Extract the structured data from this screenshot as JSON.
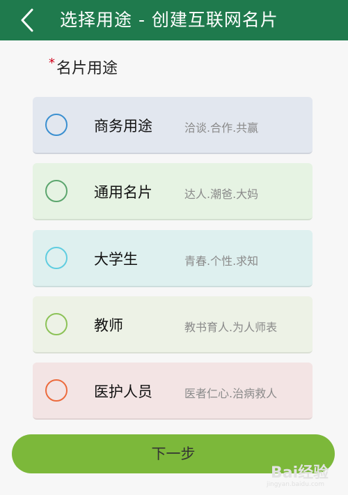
{
  "header": {
    "back_icon": "chevron-left-icon",
    "title": "选择用途 - 创建互联网名片",
    "bg": "#1f7a4d"
  },
  "section": {
    "required_mark": "*",
    "label": "名片用途"
  },
  "options": [
    {
      "name": "商务用途",
      "desc": "洽谈.合作.共赢",
      "bg": "#e2e7ef",
      "ring": "#3a8fd0"
    },
    {
      "name": "通用名片",
      "desc": "达人.潮爸.大妈",
      "bg": "#e6f3e3",
      "ring": "#5ba56d"
    },
    {
      "name": "大学生",
      "desc": "青春.个性.求知",
      "bg": "#def0ef",
      "ring": "#5fcde0"
    },
    {
      "name": "教师",
      "desc": "教书育人.为人师表",
      "bg": "#edf2e6",
      "ring": "#8cc257"
    },
    {
      "name": "医护人员",
      "desc": "医者仁心.治病救人",
      "bg": "#f3e4e4",
      "ring": "#ec6a3c"
    }
  ],
  "next_button": {
    "label": "下一步",
    "bg": "#7cb83a"
  },
  "watermark": {
    "text": "Bai经验",
    "sub": "jingyan.baidu.com"
  }
}
